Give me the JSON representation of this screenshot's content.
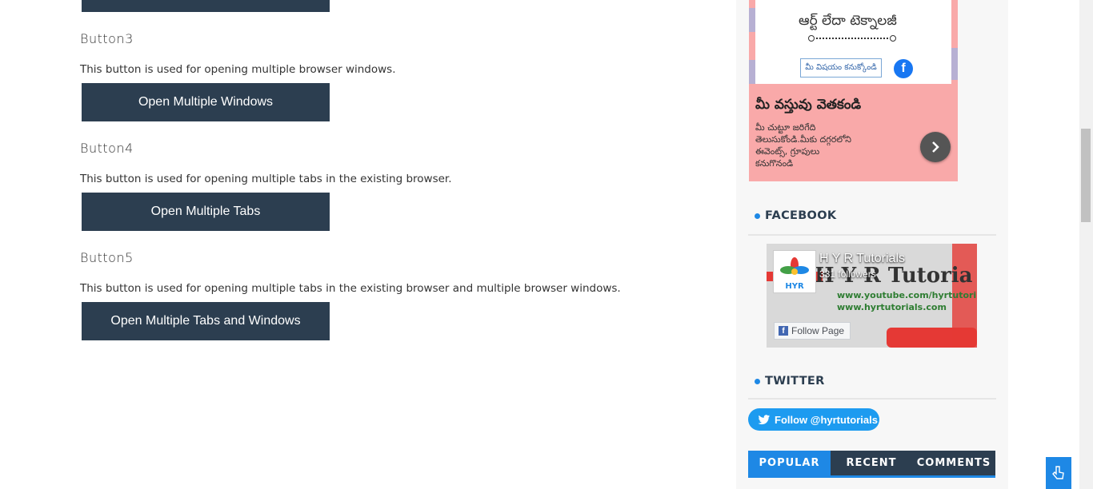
{
  "main": {
    "sections": [
      {
        "heading": "Button3",
        "description": "This button is used for opening multiple browser windows.",
        "button_label": "Open Multiple Windows"
      },
      {
        "heading": "Button4",
        "description": "This button is used for opening multiple tabs in the existing browser.",
        "button_label": "Open Multiple Tabs"
      },
      {
        "heading": "Button5",
        "description": "This button is used for opening multiple tabs in the existing browser and multiple browser windows.",
        "button_label": "Open Multiple Tabs and Windows"
      }
    ]
  },
  "ad": {
    "card_text": "ఆర్ట్   లేదా  టెక్నాలజీ",
    "chip_text": "మీ విషయం కనుక్కోండి",
    "title": "మీ వస్తువు వెతకండి",
    "description": "మీ చుట్టూ జరిగేది తెలుసుకోండి.మీకు దగ్గరలోని ఈవెంట్స్, గ్రూపులు కనుగొనండి",
    "next_icon": "chevron-right-icon"
  },
  "facebook_widget": {
    "title": "FACEBOOK",
    "page_name": "H Y R Tutorials",
    "followers": "331 followers",
    "follow_label": "Follow Page",
    "banner_text": "H Y R Tutoria",
    "banner_url1": "www.youtube.com/hyrtutori",
    "banner_url2": "www.hyrtutorials.com",
    "logo_text": "HYR"
  },
  "twitter_widget": {
    "title": "TWITTER",
    "follow_label": "Follow @hyrtutorials"
  },
  "tabs": [
    "POPULAR",
    "RECENT",
    "COMMENTS"
  ],
  "active_tab": "POPULAR",
  "colors": {
    "button_bg": "#2c3e50",
    "accent": "#1e88e5",
    "ad_bg": "#f9a9a9",
    "twitter": "#1d9bf0"
  }
}
